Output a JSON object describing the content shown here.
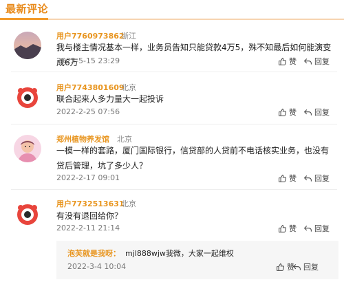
{
  "header": {
    "title": "最新评论"
  },
  "actions": {
    "like": "赞",
    "reply": "回复"
  },
  "comments": [
    {
      "user": "用户7760973862",
      "location": "浙江",
      "text": "我与楼主情况基本一样，业务员告知只能贷款4万5，殊不知最后如何能演变成6万",
      "time": "2022-5-15 23:29"
    },
    {
      "user": "用户7743801609",
      "location": "北京",
      "text": "联合起来人多力量大一起投诉",
      "time": "2022-2-25 07:56"
    },
    {
      "user": "郑州植物养发馆",
      "location": "北京",
      "text": "一模一样的套路，厦门国际银行，信贷部的人贷前不电话核实业务，也没有贷后管理，坑了多少人？",
      "time": "2022-2-17 09:01"
    },
    {
      "user": "用户7732513631",
      "location": "北京",
      "text": "有没有退回给你？",
      "time": "2022-2-11 21:14"
    }
  ],
  "reply": {
    "user": "泡芙就是我呀：",
    "text": "mjl888wjw我微，大家一起维权",
    "time": "2022-3-4 10:04"
  }
}
